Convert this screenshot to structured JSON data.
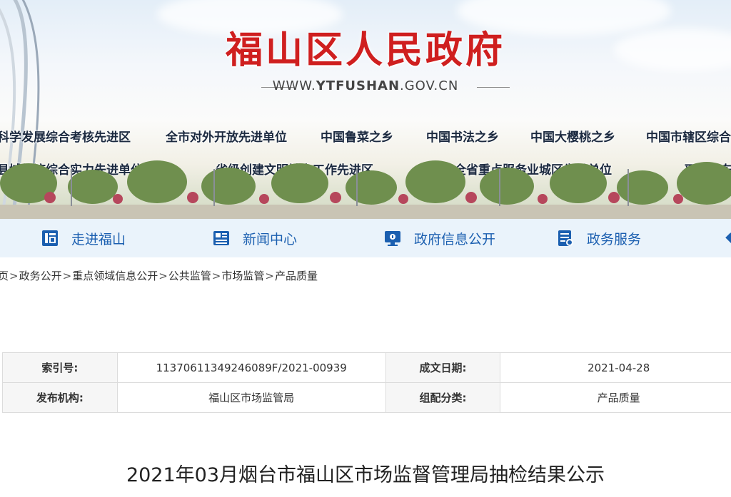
{
  "header": {
    "site_title": "福山区人民政府",
    "site_url_prefix": "WWW.",
    "site_url_main": "YTFUSHAN",
    "site_url_suffix": ".GOV.CN"
  },
  "honors": {
    "row1": [
      "科学发展综合考核先进区",
      "全市对外开放先进单位",
      "中国鲁菜之乡",
      "中国书法之乡",
      "中国大樱桃之乡",
      "中国市辖区综合"
    ],
    "row2": [
      "县域经济综合实力先进单位",
      "省级创建文明城市工作先进区",
      "全省重点服务业城区先进单位",
      "平安山东"
    ]
  },
  "nav": {
    "items": [
      {
        "label": "走进福山",
        "icon": "fu-character-icon"
      },
      {
        "label": "新闻中心",
        "icon": "news-icon"
      },
      {
        "label": "政府信息公开",
        "icon": "info-monitor-icon"
      },
      {
        "label": "政务服务",
        "icon": "service-document-icon"
      }
    ]
  },
  "breadcrumb": {
    "items": [
      "页",
      "政务公开",
      "重点领域信息公开",
      "公共监管",
      "市场监管",
      "产品质量"
    ],
    "separator": ">"
  },
  "info": {
    "index_label": "索引号:",
    "index_value": "11370611349246089F/2021-00939",
    "date_label": "成文日期:",
    "date_value": "2021-04-28",
    "publisher_label": "发布机构:",
    "publisher_value": "福山区市场监管局",
    "category_label": "组配分类:",
    "category_value": "产品质量"
  },
  "article": {
    "title": "2021年03月烟台市福山区市场监督管理局抽检结果公示"
  },
  "colors": {
    "title_red": "#cf1f1f",
    "nav_blue": "#1b5fb0",
    "nav_bg": "#eaf3fb"
  }
}
